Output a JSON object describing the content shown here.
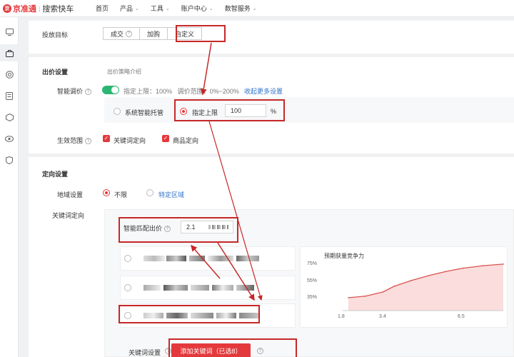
{
  "topbar": {
    "logo_mark": "京",
    "brand": "京准通",
    "product": "搜索快车",
    "nav": [
      {
        "label": "首页",
        "dropdown": false
      },
      {
        "label": "产品",
        "dropdown": true
      },
      {
        "label": "工具",
        "dropdown": true
      },
      {
        "label": "账户中心",
        "dropdown": true
      },
      {
        "label": "数智服务",
        "dropdown": true
      }
    ],
    "chevron": "⌄"
  },
  "rail": {
    "icons": [
      "monitor-icon",
      "briefcase-icon",
      "target-icon",
      "ledger-icon",
      "cube-icon",
      "eye-icon",
      "shield-icon"
    ]
  },
  "goal": {
    "label": "投放目标",
    "options": [
      {
        "label": "成交",
        "help": "?"
      },
      {
        "label": "加购"
      },
      {
        "label": "自定义"
      }
    ]
  },
  "bid": {
    "section_title": "出价设置",
    "strategy_intro": "出价策略介绍",
    "smart_label": "智能调价",
    "help": "?",
    "summary_prefix": "指定上限：100%",
    "summary_range": "调价范围：",
    "summary_range_value": "0%~200%",
    "more_link": "收起更多设置",
    "option_system": "系统智能托管",
    "option_cap": "指定上限",
    "cap_value": "100",
    "cap_unit": "%",
    "scope_label": "生效范围",
    "scope_keyword": "关键词定向",
    "scope_product": "商品定向",
    "check_mark": "✓"
  },
  "targeting": {
    "section_title": "定向设置",
    "region_label": "地域设置",
    "region_all": "不限",
    "region_specific": "特定区域",
    "keyword_label": "关键词定向",
    "smart_match_label": "智能匹配出价",
    "smart_match_value": "2.1",
    "chart": {
      "title": "预期获量竞争力"
    },
    "keyword_setting_label": "关键词设置",
    "add_keyword_button": "添加关键词（已选8）",
    "help": "?"
  },
  "chart_data": {
    "type": "area",
    "title": "预期获量竞争力",
    "x_ticks": [
      "1.8",
      "3.4",
      "6.5"
    ],
    "y_ticks": [
      "75%",
      "55%",
      "35%"
    ],
    "x": [
      1.8,
      2.4,
      3.0,
      3.4,
      4.0,
      4.6,
      5.2,
      5.8,
      6.5,
      7.2
    ],
    "values": [
      35,
      37,
      42,
      49,
      56,
      62,
      67,
      71,
      74,
      76
    ],
    "colors": {
      "line": "#d9534f",
      "fill": "#f6c7c5"
    },
    "grid": false
  }
}
